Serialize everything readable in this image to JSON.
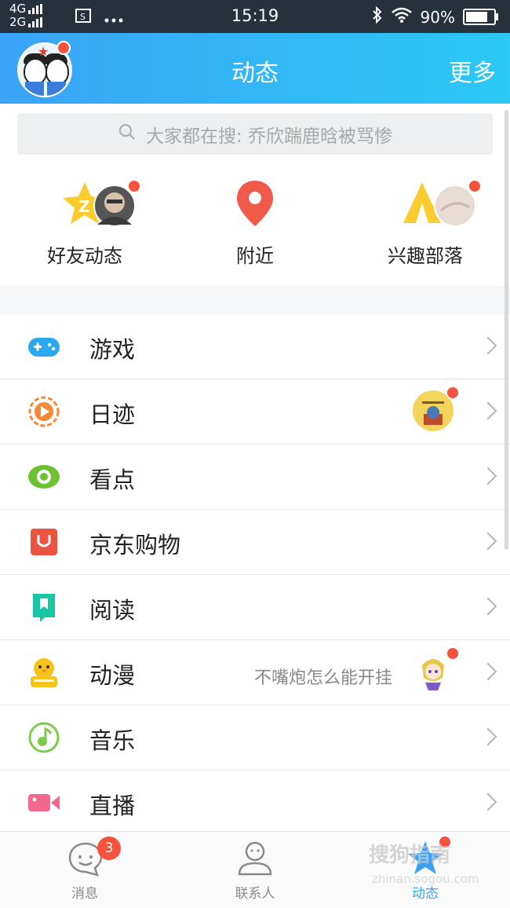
{
  "status_bar": {
    "network_top": "4G",
    "network_bottom": "2G",
    "time": "15:19",
    "battery_percent": "90%",
    "battery_level": 0.9,
    "icons": [
      "signal-icon",
      "screenshot-icon",
      "more-dots-icon",
      "bluetooth-icon",
      "wifi-icon",
      "battery-icon"
    ]
  },
  "header": {
    "title": "动态",
    "more_label": "更多"
  },
  "search": {
    "placeholder": "大家都在搜: 乔欣踹鹿晗被骂惨"
  },
  "shortcuts": [
    {
      "label": "好友动态",
      "icon": "friends-feed-icon"
    },
    {
      "label": "附近",
      "icon": "location-pin-icon"
    },
    {
      "label": "兴趣部落",
      "icon": "tribe-tent-icon"
    }
  ],
  "menu": [
    {
      "label": "游戏",
      "icon": "gamepad-icon",
      "color": "#2aa8f2"
    },
    {
      "label": "日迹",
      "icon": "play-circle-icon",
      "color": "#f6883a"
    },
    {
      "label": "看点",
      "icon": "eye-icon",
      "color": "#6cc230"
    },
    {
      "label": "京东购物",
      "icon": "shopping-bag-icon",
      "color": "#e9533f"
    },
    {
      "label": "阅读",
      "icon": "bookmark-icon",
      "color": "#19c6a4"
    },
    {
      "label": "动漫",
      "icon": "chick-icon",
      "color": "#f7c21a",
      "hint": "不嘴炮怎么能开挂"
    },
    {
      "label": "音乐",
      "icon": "music-note-icon",
      "color": "#7dc94a"
    },
    {
      "label": "直播",
      "icon": "video-camera-icon",
      "color": "#f4668d"
    }
  ],
  "tabs": [
    {
      "label": "消息",
      "icon": "message-icon",
      "badge": "3"
    },
    {
      "label": "联系人",
      "icon": "contact-icon"
    },
    {
      "label": "动态",
      "icon": "star-icon",
      "active": true
    }
  ],
  "watermark": {
    "text": "搜狗指南",
    "url": "zhinan.sogou.com"
  },
  "colors": {
    "header_start": "#3aa3f7",
    "header_end": "#2bc9f4",
    "badge": "#f5533d",
    "active_tab": "#3aa3f7"
  }
}
